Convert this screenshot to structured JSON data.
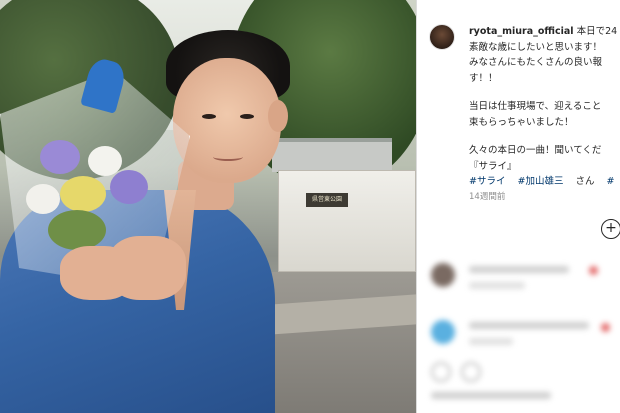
{
  "post": {
    "username": "ryota_miura_official",
    "caption_lines": [
      "本日で24",
      "素敵な歳にしたいと思います！",
      "みなさんにもたくさんの良い報",
      "す！！",
      "当日は仕事現場で、迎えること",
      "束もらっちゃいました！",
      "久々の本日の一曲！聞いてくだ",
      "『サライ』"
    ],
    "hashtags": [
      "#サライ",
      "#加山雄三"
    ],
    "hashtag_suffix": "さん",
    "hashtag_trailing": "#",
    "timestamp": "14週間前",
    "more_label": "+"
  },
  "photo": {
    "park_sign": "県営東公園"
  },
  "icons": [
    "plus-circle-icon",
    "heart-icon",
    "comment-icon"
  ],
  "colors": {
    "link": "#00376b",
    "text": "#262626",
    "muted": "#8e8e8e",
    "robe": "#3564a4",
    "ribbon": "#2f74c8"
  }
}
